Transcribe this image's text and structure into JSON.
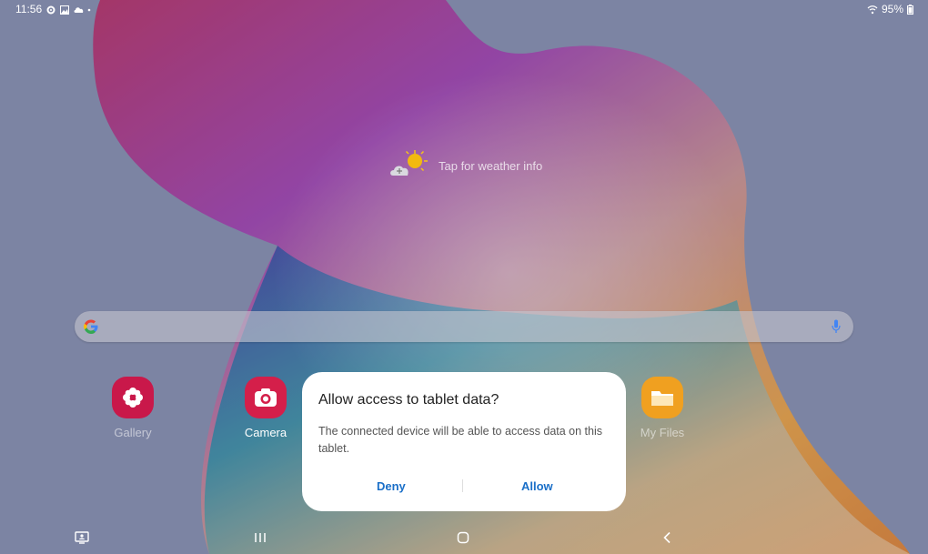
{
  "status_bar": {
    "time": "11:56",
    "battery": "95%",
    "left_icons": [
      "gear-icon",
      "image-icon",
      "cloud-icon",
      "dot-icon"
    ],
    "right_icons": [
      "wifi-icon",
      "battery-icon"
    ]
  },
  "weather": {
    "label": "Tap for weather info",
    "icon": "sun-cloud-icon"
  },
  "search": {
    "logo": "google-g-icon",
    "mic": "mic-icon"
  },
  "apps": [
    {
      "label": "Gallery",
      "color": "#c9184a"
    },
    {
      "label": "Camera",
      "color": "#d41f4a"
    },
    {
      "label": "My Files",
      "color": "#f0a020"
    }
  ],
  "dialog": {
    "title": "Allow access to tablet data?",
    "message": "The connected device will be able to access data on this tablet.",
    "deny_label": "Deny",
    "allow_label": "Allow",
    "button_color": "#1a6fc8"
  },
  "nav_bar": {
    "buttons": [
      "screen-icon",
      "recents-icon",
      "home-icon",
      "back-icon"
    ]
  }
}
